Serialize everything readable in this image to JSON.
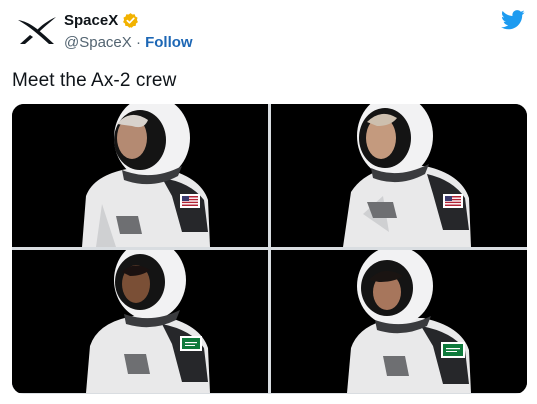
{
  "account": {
    "name": "SpaceX",
    "handle": "@SpaceX",
    "separator": "·",
    "follow_label": "Follow",
    "verified_color": "#f2b200"
  },
  "icons": {
    "logo": "spacex-x-logo",
    "verified": "verified-badge-icon",
    "platform": "twitter-bird-icon"
  },
  "tweet": {
    "text": "Meet the Ax-2 crew"
  },
  "photos": [
    {
      "alt": "crew-member-1",
      "flag": "us",
      "helmet": "white",
      "suit": "white"
    },
    {
      "alt": "crew-member-2",
      "flag": "us",
      "helmet": "white",
      "suit": "white"
    },
    {
      "alt": "crew-member-3",
      "flag": "saudi",
      "helmet": "white",
      "suit": "white"
    },
    {
      "alt": "crew-member-4",
      "flag": "saudi",
      "helmet": "white",
      "suit": "white"
    }
  ],
  "colors": {
    "link": "#1d67b5",
    "twitter_blue": "#1d9bf0",
    "photo_background": "#000000",
    "secondary_text": "#536471"
  }
}
